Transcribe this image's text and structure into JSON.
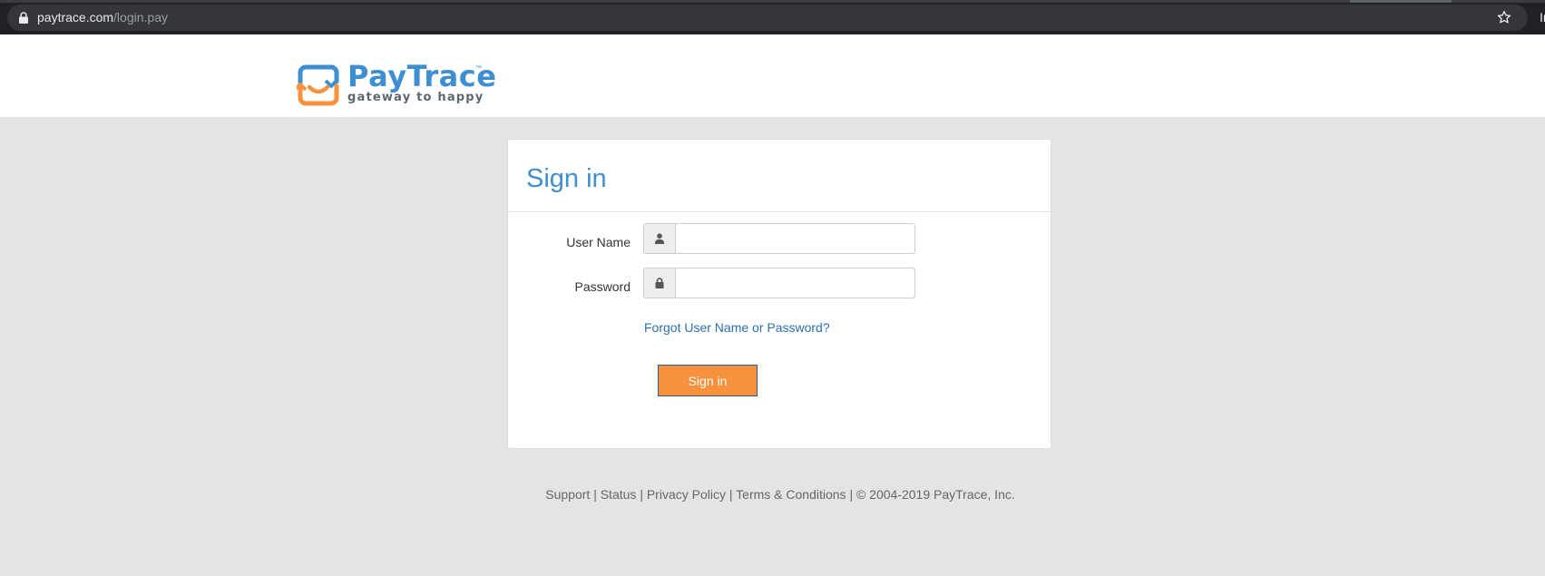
{
  "browser": {
    "url_domain": "paytrace.com",
    "url_path": "/login.pay",
    "edge_text": "In"
  },
  "header": {
    "brand_name": "PayTrace",
    "brand_tm": "™",
    "tagline": "gateway to happy",
    "colors": {
      "brand_blue": "#3d8fd1",
      "brand_orange": "#f7913d"
    }
  },
  "signin": {
    "title": "Sign in",
    "username_label": "User Name",
    "username_value": "",
    "username_icon": "user-icon",
    "password_label": "Password",
    "password_value": "",
    "password_icon": "lock-icon",
    "forgot_link": "Forgot User Name or Password?",
    "submit_label": "Sign in"
  },
  "footer": {
    "links": [
      "Support",
      "Status",
      "Privacy Policy",
      "Terms & Conditions"
    ],
    "separator": "|",
    "copyright": "© 2004-2019 PayTrace, Inc."
  }
}
